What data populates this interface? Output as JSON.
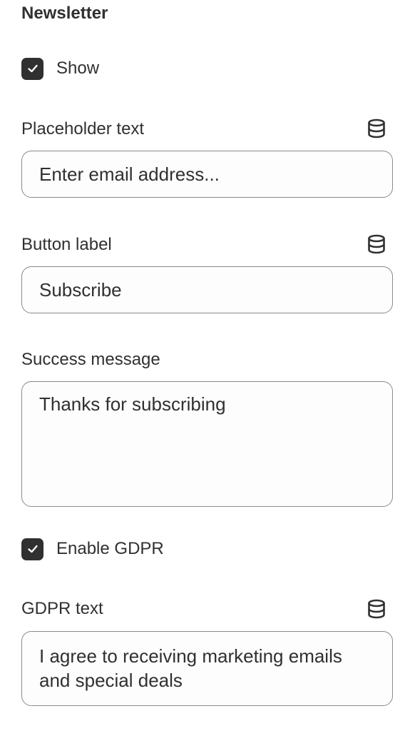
{
  "section": {
    "title": "Newsletter"
  },
  "show_checkbox": {
    "label": "Show",
    "checked": true
  },
  "placeholder_field": {
    "label": "Placeholder text",
    "value": "Enter email address...",
    "icon": "database-icon"
  },
  "button_label_field": {
    "label": "Button label",
    "value": "Subscribe",
    "icon": "database-icon"
  },
  "success_message_field": {
    "label": "Success message",
    "value": "Thanks for subscribing"
  },
  "gdpr_checkbox": {
    "label": "Enable GDPR",
    "checked": true
  },
  "gdpr_text_field": {
    "label": "GDPR text",
    "value": "I agree to receiving marketing emails and special deals",
    "icon": "database-icon"
  },
  "colors": {
    "text": "#303030",
    "checkbox_fill": "#303030",
    "input_border": "#8a8a8a"
  }
}
